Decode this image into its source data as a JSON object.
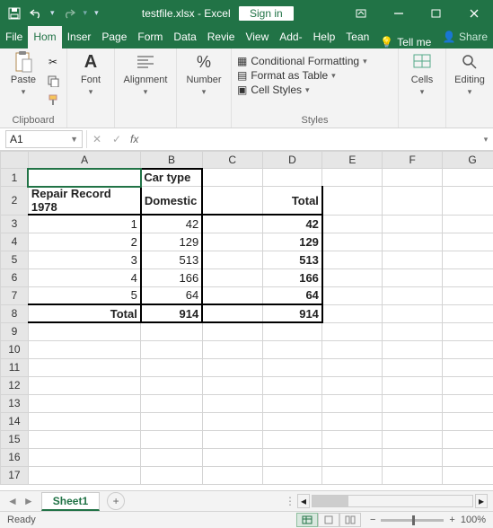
{
  "app": {
    "filename": "testfile.xlsx",
    "product": "Excel",
    "signin": "Sign in"
  },
  "menus": {
    "file": "File",
    "home": "Hom",
    "insert": "Inser",
    "page": "Page",
    "form": "Form",
    "data": "Data",
    "review": "Revie",
    "view": "View",
    "add": "Add-",
    "help": "Help",
    "team": "Tean",
    "tellme": "Tell me",
    "share": "Share"
  },
  "ribbon": {
    "clipboard": {
      "paste": "Paste",
      "label": "Clipboard"
    },
    "font": {
      "btn": "Font"
    },
    "alignment": {
      "btn": "Alignment"
    },
    "number": {
      "btn": "Number"
    },
    "styles": {
      "cond": "Conditional Formatting",
      "table": "Format as Table",
      "cell": "Cell Styles",
      "label": "Styles"
    },
    "cells": {
      "btn": "Cells"
    },
    "editing": {
      "btn": "Editing"
    }
  },
  "namebox": "A1",
  "formula": "",
  "columns": [
    "A",
    "B",
    "C",
    "D",
    "E",
    "F",
    "G"
  ],
  "rows": [
    "1",
    "2",
    "3",
    "4",
    "5",
    "6",
    "7",
    "8",
    "9",
    "10",
    "11",
    "12",
    "13",
    "14",
    "15",
    "16",
    "17"
  ],
  "cells": {
    "B1": "Car type",
    "A2": "Repair Record 1978",
    "B2": "Domestic",
    "D2": "Total",
    "A3": "1",
    "B3": "42",
    "D3": "42",
    "A4": "2",
    "B4": "129",
    "D4": "129",
    "A5": "3",
    "B5": "513",
    "D5": "513",
    "A6": "4",
    "B6": "166",
    "D6": "166",
    "A7": "5",
    "B7": "64",
    "D7": "64",
    "A8": "Total",
    "B8": "914",
    "D8": "914"
  },
  "chart_data": {
    "type": "table",
    "title": "Car type",
    "row_field": "Repair Record 1978",
    "columns": [
      "Domestic",
      "Total"
    ],
    "categories": [
      "1",
      "2",
      "3",
      "4",
      "5"
    ],
    "series": [
      {
        "name": "Domestic",
        "values": [
          42,
          129,
          513,
          166,
          64
        ]
      },
      {
        "name": "Total",
        "values": [
          42,
          129,
          513,
          166,
          64
        ]
      }
    ],
    "totals": {
      "Domestic": 914,
      "Total": 914
    }
  },
  "sheets": {
    "active": "Sheet1"
  },
  "status": {
    "ready": "Ready",
    "zoom": "100%"
  }
}
